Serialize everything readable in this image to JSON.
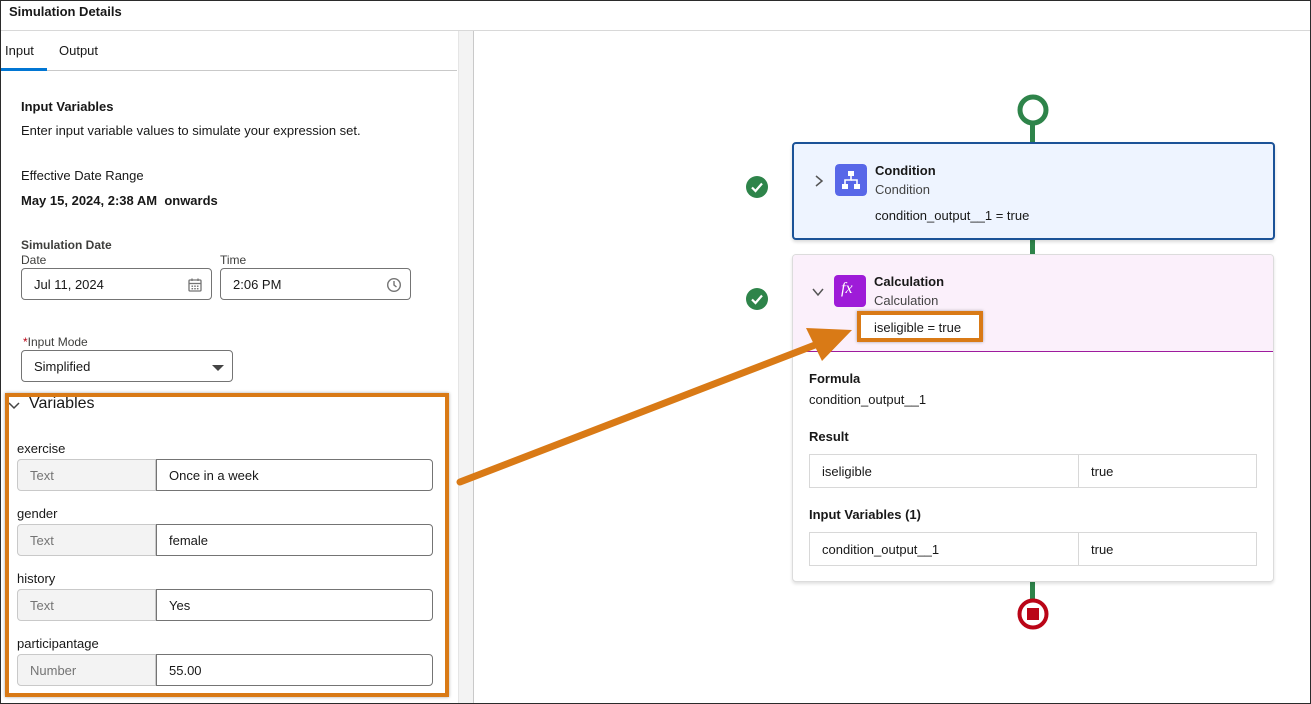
{
  "window": {
    "title": "Simulation Details"
  },
  "tabs": [
    {
      "label": "Input"
    },
    {
      "label": "Output"
    }
  ],
  "input_panel": {
    "heading": "Input Variables",
    "description": "Enter input variable values to simulate your expression set.",
    "effective_label": "Effective Date Range",
    "effective_value": "May 15, 2024, 2:38 AM  onwards",
    "simulation_date_label": "Simulation Date",
    "date_label": "Date",
    "date_value": "Jul 11, 2024",
    "time_label": "Time",
    "time_value": "2:06 PM",
    "required_mark": "*",
    "input_mode_label": "Input Mode",
    "input_mode_value": "Simplified",
    "variables_heading": "Variables",
    "variables": [
      {
        "name": "exercise",
        "type": "Text",
        "value": "Once in a week"
      },
      {
        "name": "gender",
        "type": "Text",
        "value": "female"
      },
      {
        "name": "history",
        "type": "Text",
        "value": "Yes"
      },
      {
        "name": "participantage",
        "type": "Number",
        "value": "55.00"
      }
    ]
  },
  "canvas": {
    "condition": {
      "title": "Condition",
      "subtitle": "Condition",
      "output": "condition_output__1 = true"
    },
    "calculation": {
      "title": "Calculation",
      "subtitle": "Calculation",
      "output": "iseligible = true",
      "icon_glyph": "fx",
      "formula_label": "Formula",
      "formula_value": "condition_output__1",
      "result_label": "Result",
      "result_rows": [
        {
          "name": "iseligible",
          "value": "true"
        }
      ],
      "input_vars_label": "Input Variables (1)",
      "input_rows": [
        {
          "name": "condition_output__1",
          "value": "true"
        }
      ]
    }
  },
  "colors": {
    "accent": "#0176d3",
    "success": "#2e844a",
    "stop": "#ba0517",
    "highlight": "#d97a16",
    "condition_badge": "#5867e8",
    "calculation_badge": "#9e1bd8"
  }
}
